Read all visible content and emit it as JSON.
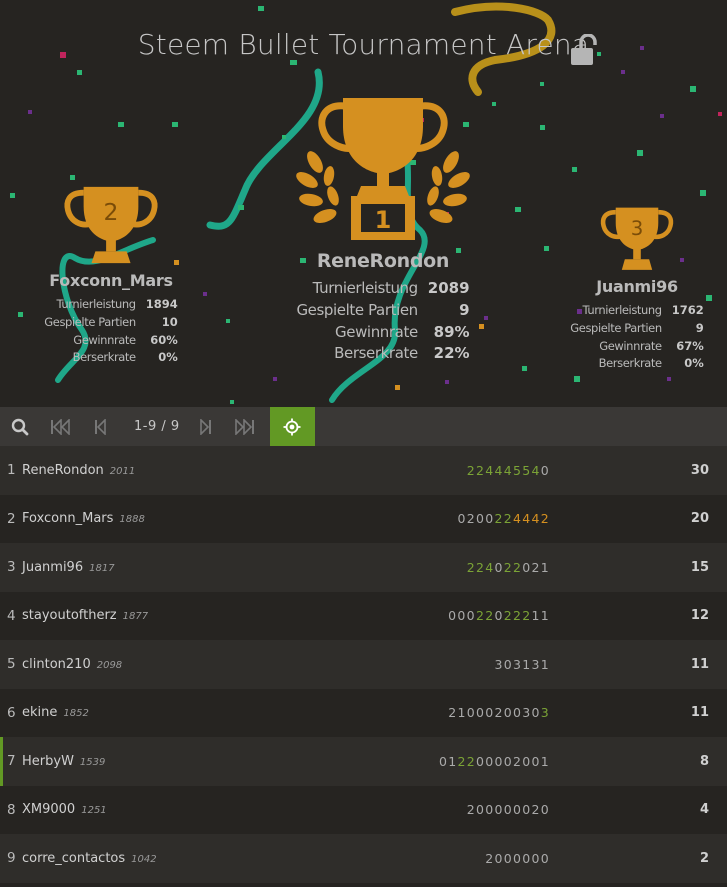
{
  "tournament": {
    "title": "Steem Bullet Tournament Arena",
    "lock_icon": "unlocked-lock-icon"
  },
  "colors": {
    "accent": "#629924",
    "trophy": "#d59020",
    "background": "#262421"
  },
  "podium": {
    "first": {
      "rank": "1",
      "name": "ReneRondon",
      "stats": [
        {
          "label": "Turnierleistung",
          "value": "2089"
        },
        {
          "label": "Gespielte Partien",
          "value": "9"
        },
        {
          "label": "Gewinnrate",
          "value": "89%"
        },
        {
          "label": "Berserkrate",
          "value": "22%"
        }
      ]
    },
    "second": {
      "rank": "2",
      "name": "Foxconn_Mars",
      "stats": [
        {
          "label": "Turnierleistung",
          "value": "1894"
        },
        {
          "label": "Gespielte Partien",
          "value": "10"
        },
        {
          "label": "Gewinnrate",
          "value": "60%"
        },
        {
          "label": "Berserkrate",
          "value": "0%"
        }
      ]
    },
    "third": {
      "rank": "3",
      "name": "Juanmi96",
      "stats": [
        {
          "label": "Turnierleistung",
          "value": "1762"
        },
        {
          "label": "Gespielte Partien",
          "value": "9"
        },
        {
          "label": "Gewinnrate",
          "value": "67%"
        },
        {
          "label": "Berserkrate",
          "value": "0%"
        }
      ]
    }
  },
  "pager": {
    "page_info": "1-9 / 9"
  },
  "standings": [
    {
      "rank": "1",
      "name": "ReneRondon",
      "rating": "2011",
      "sheet": [
        [
          "w",
          "22444554"
        ],
        [
          "n",
          "0"
        ]
      ],
      "total": "30"
    },
    {
      "rank": "2",
      "name": "Foxconn_Mars",
      "rating": "1888",
      "sheet": [
        [
          "n",
          "0200"
        ],
        [
          "w",
          "22"
        ],
        [
          "f",
          "4442"
        ]
      ],
      "total": "20"
    },
    {
      "rank": "3",
      "name": "Juanmi96",
      "rating": "1817",
      "sheet": [
        [
          "w",
          "224"
        ],
        [
          "n",
          "0"
        ],
        [
          "w",
          "22"
        ],
        [
          "n",
          "021"
        ]
      ],
      "total": "15"
    },
    {
      "rank": "4",
      "name": "stayoutoftherz",
      "rating": "1877",
      "sheet": [
        [
          "n",
          "000"
        ],
        [
          "w",
          "22"
        ],
        [
          "n",
          "0"
        ],
        [
          "w",
          "222"
        ],
        [
          "n",
          "11"
        ]
      ],
      "total": "12"
    },
    {
      "rank": "5",
      "name": "clinton210",
      "rating": "2098",
      "sheet": [
        [
          "n",
          "303131"
        ]
      ],
      "total": "11"
    },
    {
      "rank": "6",
      "name": "ekine",
      "rating": "1852",
      "sheet": [
        [
          "n",
          "2100020030"
        ],
        [
          "w",
          "3"
        ]
      ],
      "total": "11"
    },
    {
      "rank": "7",
      "name": "HerbyW",
      "rating": "1539",
      "sheet": [
        [
          "n",
          "01"
        ],
        [
          "w",
          "22"
        ],
        [
          "n",
          "00002001"
        ]
      ],
      "total": "8",
      "me": true
    },
    {
      "rank": "8",
      "name": "XM9000",
      "rating": "1251",
      "sheet": [
        [
          "n",
          "200000020"
        ]
      ],
      "total": "4"
    },
    {
      "rank": "9",
      "name": "corre_contactos",
      "rating": "1042",
      "sheet": [
        [
          "n",
          "2000000"
        ]
      ],
      "total": "2"
    }
  ]
}
